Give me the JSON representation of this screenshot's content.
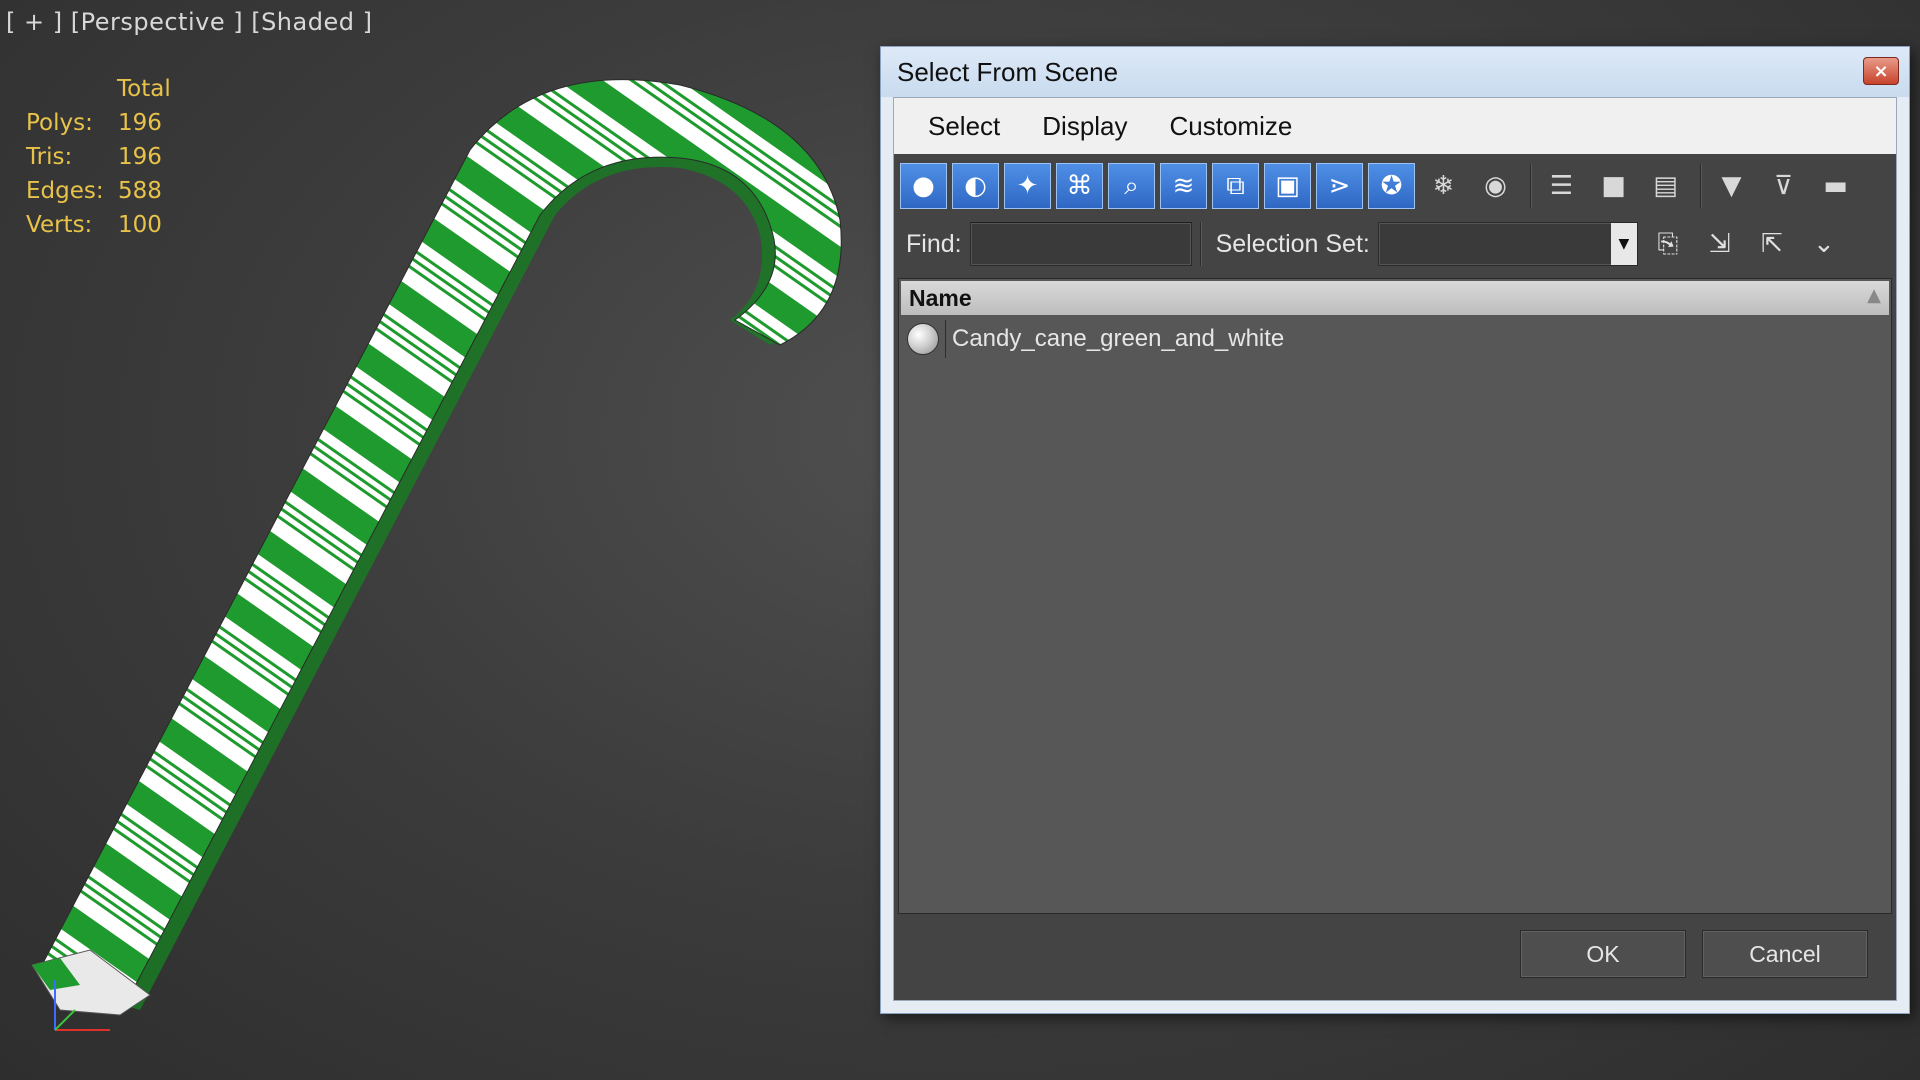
{
  "viewport": {
    "label": "[ + ] [Perspective ] [Shaded ]",
    "stats": {
      "header": "Total",
      "rows": [
        {
          "key": "Polys:",
          "value": "196"
        },
        {
          "key": "Tris:",
          "value": "196"
        },
        {
          "key": "Edges:",
          "value": "588"
        },
        {
          "key": "Verts:",
          "value": "100"
        }
      ]
    },
    "model": "candy-cane",
    "colors": {
      "stripe": "#1f9a2e",
      "base": "#ffffff",
      "stats": "#e8c34a"
    }
  },
  "dialog": {
    "title": "Select From Scene",
    "close_label": "×",
    "menu": [
      "Select",
      "Display",
      "Customize"
    ],
    "toolbar_icons": [
      {
        "name": "geometry-icon",
        "glyph": "●",
        "active": true
      },
      {
        "name": "shapes-icon",
        "glyph": "◐",
        "active": true
      },
      {
        "name": "lights-icon",
        "glyph": "✦",
        "active": true
      },
      {
        "name": "cameras-icon",
        "glyph": "⌘",
        "active": true
      },
      {
        "name": "helpers-icon",
        "glyph": "⌕",
        "active": true
      },
      {
        "name": "space-warps-icon",
        "glyph": "≋",
        "active": true
      },
      {
        "name": "groups-icon",
        "glyph": "⧉",
        "active": true
      },
      {
        "name": "xrefs-icon",
        "glyph": "▣",
        "active": true
      },
      {
        "name": "bones-icon",
        "glyph": "⋗",
        "active": true
      },
      {
        "name": "containers-icon",
        "glyph": "✪",
        "active": true
      },
      {
        "name": "frozen-icon",
        "glyph": "❄",
        "active": false
      },
      {
        "name": "hidden-icon",
        "glyph": "◉",
        "active": false
      },
      {
        "name": "display-all-icon",
        "glyph": "☰",
        "active": false
      },
      {
        "name": "display-none-icon",
        "glyph": "■",
        "active": false
      },
      {
        "name": "display-invert-icon",
        "glyph": "▤",
        "active": false
      },
      {
        "name": "filter-icon",
        "glyph": "▼",
        "active": false
      },
      {
        "name": "filter-options-icon",
        "glyph": "⊽",
        "active": false
      },
      {
        "name": "columns-icon",
        "glyph": "▬",
        "active": false
      }
    ],
    "find_label": "Find:",
    "find_value": "",
    "selection_set_label": "Selection Set:",
    "selection_set_value": "",
    "list": {
      "header": "Name",
      "items": [
        {
          "name": "Candy_cane_green_and_white",
          "icon": "geometry-sphere-icon"
        }
      ]
    },
    "ok_label": "OK",
    "cancel_label": "Cancel"
  }
}
